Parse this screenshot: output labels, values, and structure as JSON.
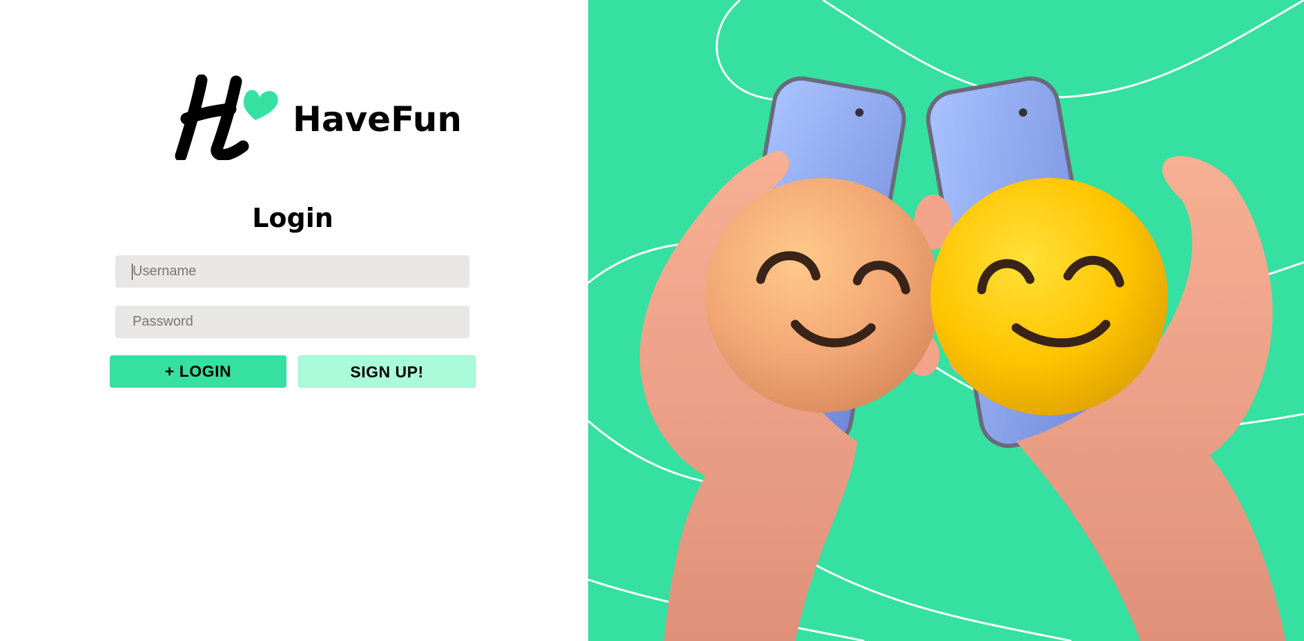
{
  "brand": {
    "name": "HaveFun",
    "logo_letter": "H",
    "logo_icon": "heart-icon",
    "accent_color": "#35e0a1"
  },
  "login": {
    "title": "Login",
    "username_placeholder": "Username",
    "password_placeholder": "Password",
    "login_button_label": "+ LOGIN",
    "signup_button_label": "SIGN UP!"
  },
  "colors": {
    "hero_background": "#35e0a1",
    "login_button": "#35e0a1",
    "signup_button": "#a9fbd9",
    "field_background": "#e8e7e5"
  },
  "hero_image": {
    "subject": "two-hands-holding-phones-with-smiley-faces"
  }
}
